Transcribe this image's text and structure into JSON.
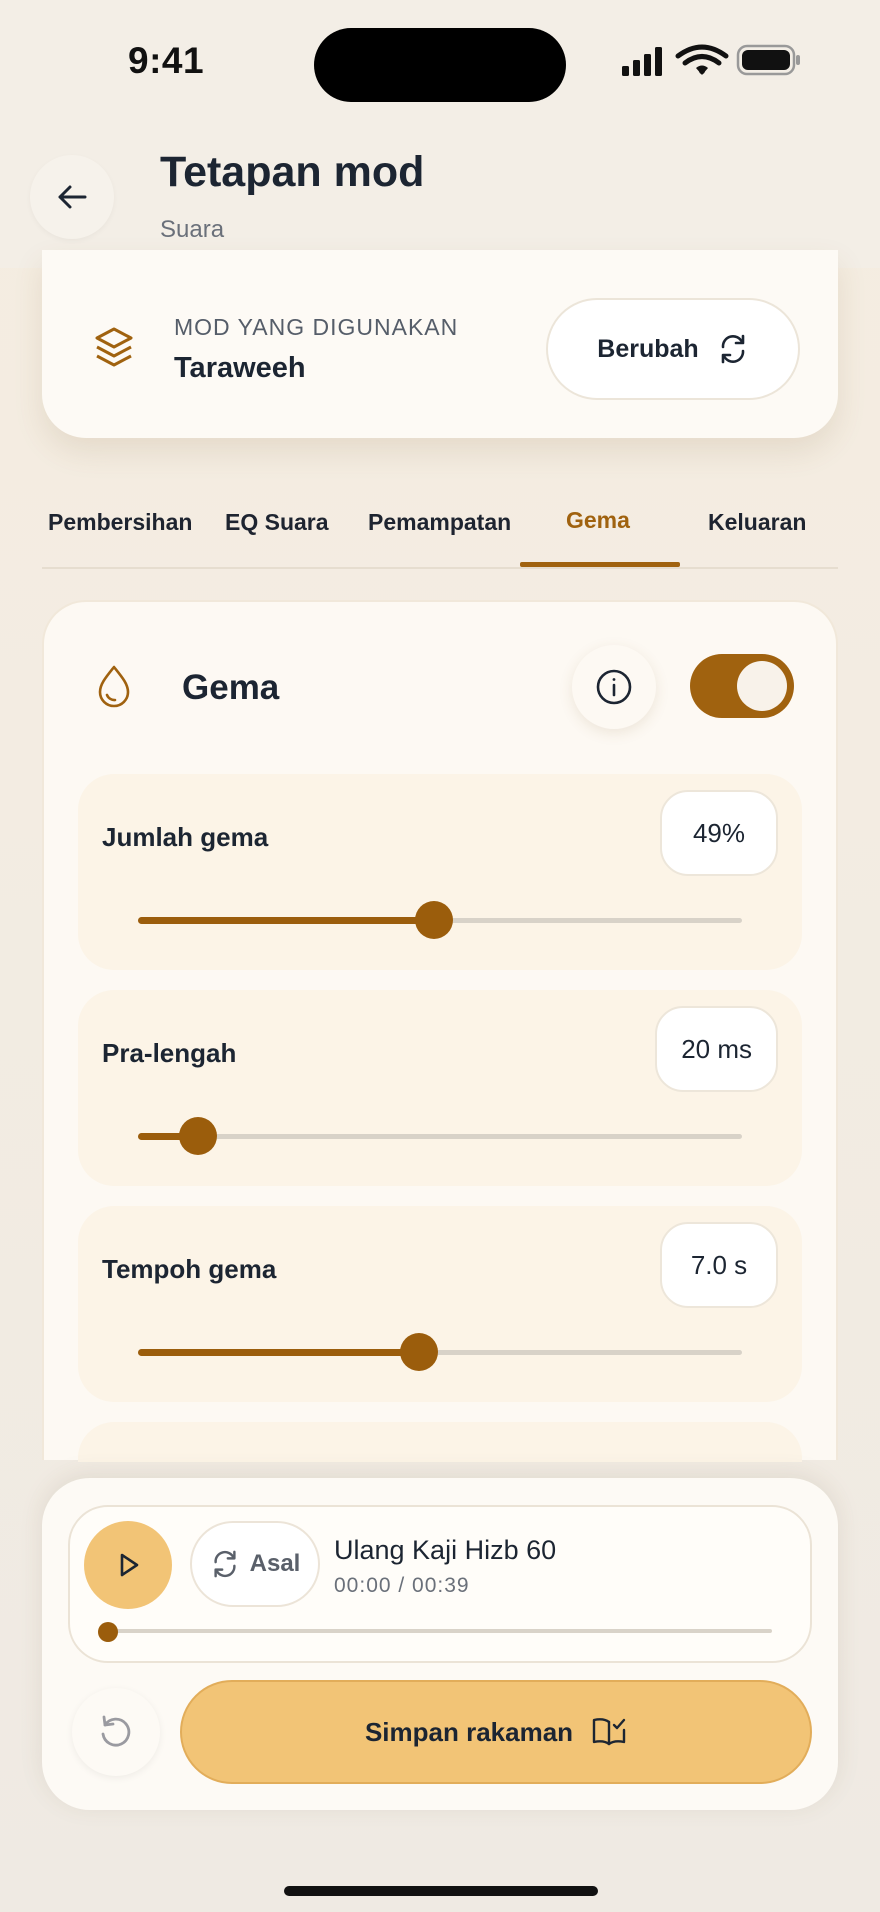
{
  "status_bar": {
    "time": "9:41"
  },
  "header": {
    "title": "Tetapan mod",
    "subtitle": "Suara"
  },
  "mode_card": {
    "label": "MOD YANG DIGUNAKAN",
    "value": "Taraweeh",
    "change_label": "Berubah"
  },
  "tabs": [
    {
      "label": "Pembersihan",
      "active": false
    },
    {
      "label": "EQ Suara",
      "active": false
    },
    {
      "label": "Pemampatan",
      "active": false
    },
    {
      "label": "Gema",
      "active": true
    },
    {
      "label": "Keluaran",
      "active": false
    }
  ],
  "section": {
    "title": "Gema",
    "enabled": true
  },
  "params": [
    {
      "label": "Jumlah gema",
      "value": "49%",
      "level": 0.49
    },
    {
      "label": "Pra-lengah",
      "value": "20 ms",
      "level": 0.1
    },
    {
      "label": "Tempoh gema",
      "value": "7.0 s",
      "level": 0.465
    }
  ],
  "player": {
    "original_label": "Asal",
    "track_name": "Ulang Kaji Hizb 60",
    "track_time": "00:00 / 00:39",
    "progress": 0
  },
  "save_label": "Simpan rakaman",
  "colors": {
    "accent": "#a0620f",
    "button": "#f2c476",
    "background": "#f3ece2"
  }
}
